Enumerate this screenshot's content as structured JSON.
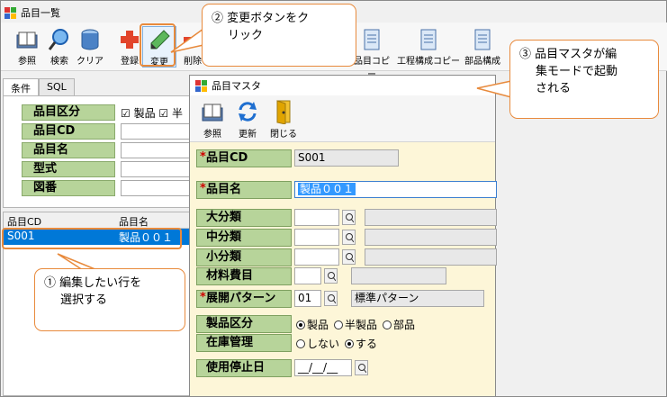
{
  "back_window": {
    "title": "品目一覧",
    "toolbar": [
      {
        "label": "参照",
        "icon": "book-icon"
      },
      {
        "label": "検索",
        "icon": "search-icon"
      },
      {
        "label": "クリア",
        "icon": "clear-icon"
      },
      {
        "label": "登録",
        "icon": "plus-icon"
      },
      {
        "label": "変更",
        "icon": "pencil-icon"
      },
      {
        "label": "削除",
        "icon": "minus-icon"
      },
      {
        "label": "品目コピー",
        "icon": "document-icon"
      },
      {
        "label": "工程構成コピー",
        "icon": "document-icon"
      },
      {
        "label": "部品構成",
        "icon": "document-icon"
      }
    ],
    "tabs": [
      "条件",
      "SQL"
    ],
    "conditions": [
      {
        "label": "品目区分"
      },
      {
        "label": "品目CD"
      },
      {
        "label": "品目名"
      },
      {
        "label": "型式"
      },
      {
        "label": "図番"
      }
    ],
    "item_type_checks": [
      "☑ 製品",
      "☑ 半"
    ],
    "grid": {
      "columns": [
        "品目CD",
        "品目名"
      ],
      "rows": [
        [
          "S001",
          "製品００１"
        ]
      ]
    }
  },
  "front_window": {
    "title": "品目マスタ",
    "toolbar": [
      {
        "label": "参照",
        "icon": "book-icon"
      },
      {
        "label": "更新",
        "icon": "refresh-icon"
      },
      {
        "label": "閉じる",
        "icon": "door-icon"
      }
    ],
    "fields": {
      "item_cd": {
        "label": "品目CD",
        "required": "*",
        "value": "S001"
      },
      "item_name": {
        "label": "品目名",
        "required": "*",
        "value": "製品００１"
      },
      "major": {
        "label": "大分類"
      },
      "middle": {
        "label": "中分類"
      },
      "minor": {
        "label": "小分類"
      },
      "material": {
        "label": "材料費目"
      },
      "pattern": {
        "label": "展開パターン",
        "required": "*",
        "code": "01",
        "name": "標準パターン"
      },
      "item_type": {
        "label": "製品区分",
        "options": [
          "製品",
          "半製品",
          "部品"
        ],
        "selected": "製品"
      },
      "stock": {
        "label": "在庫管理",
        "options": [
          "しない",
          "する"
        ],
        "selected": "する"
      },
      "stop_date": {
        "label": "使用停止日",
        "value": "__/__/__"
      }
    }
  },
  "callouts": {
    "c1": {
      "line1": "①  編集したい行を",
      "line2": "選択する"
    },
    "c2": {
      "line1": "②  変更ボタンをク",
      "line2": "リック"
    },
    "c3": {
      "line1": "③  品目マスタが編",
      "line2": "集モードで起動",
      "line3": "される"
    }
  },
  "colors": {
    "accent": "#e88a3c",
    "label_green": "#b7d49a",
    "selection": "#0078d7",
    "form_bg": "#fdf6d8"
  }
}
